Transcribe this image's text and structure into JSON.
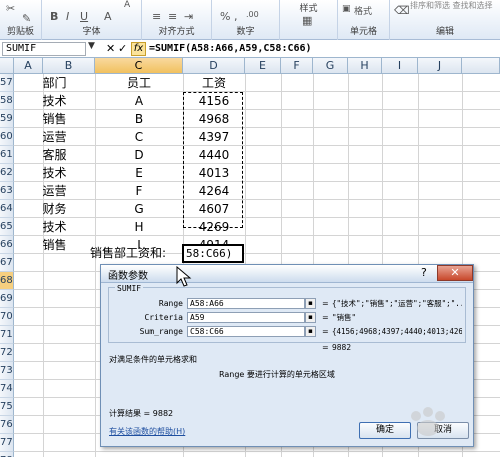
{
  "ribbon": {
    "groups": [
      {
        "label": "剪贴板",
        "icon": "paste-icon"
      },
      {
        "label": "字体",
        "icon": "bold-icon"
      },
      {
        "label": "对齐方式",
        "icon": "align-icon"
      },
      {
        "label": "数字",
        "icon": "percent-icon"
      },
      {
        "label": "样式",
        "icon": "styles-icon"
      },
      {
        "label": "单元格",
        "icon": "cells-icon"
      },
      {
        "label": "编辑",
        "icon": "edit-icon"
      }
    ],
    "styles_top": "样式",
    "sort_filter": "排序和筛选 查找和选择",
    "format_label": "格式"
  },
  "formula_bar": {
    "name_box": "SUMIF",
    "cancel_icon": "✕",
    "enter_icon": "✓",
    "fx_label": "fx",
    "formula": "=SUMIF(A58:A66,A59,C58:C66)"
  },
  "sheet": {
    "columns": [
      "A",
      "B",
      "C",
      "D",
      "E",
      "F",
      "G",
      "H",
      "I",
      "J"
    ],
    "selected_column": "C",
    "rows": [
      "57",
      "58",
      "59",
      "60",
      "61",
      "62",
      "63",
      "64",
      "65",
      "66",
      "67",
      "68",
      "69",
      "70",
      "71",
      "72",
      "73",
      "74",
      "75",
      "76",
      "77",
      "78"
    ],
    "selected_row": "68",
    "header_row": {
      "dept": "部门",
      "employee": "员工",
      "salary": "工资"
    },
    "data": [
      {
        "dept": "技术",
        "employee": "A",
        "salary": "4156"
      },
      {
        "dept": "销售",
        "employee": "B",
        "salary": "4968"
      },
      {
        "dept": "运营",
        "employee": "C",
        "salary": "4397"
      },
      {
        "dept": "客服",
        "employee": "D",
        "salary": "4440"
      },
      {
        "dept": "技术",
        "employee": "E",
        "salary": "4013"
      },
      {
        "dept": "运营",
        "employee": "F",
        "salary": "4264"
      },
      {
        "dept": "财务",
        "employee": "G",
        "salary": "4607"
      },
      {
        "dept": "技术",
        "employee": "H",
        "salary": "4269"
      },
      {
        "dept": "销售",
        "employee": "I",
        "salary": "4914"
      }
    ],
    "sum_label": "销售部工资和:",
    "editing_cell_text": "58:C66)"
  },
  "dialog": {
    "title": "函数参数",
    "help_glyph": "?",
    "close_glyph": "✕",
    "function_name": "SUMIF",
    "args": [
      {
        "label": "Range",
        "value": "A58:A66",
        "result": "{\"技术\";\"销售\";\"运营\";\"客服\";\"..."
      },
      {
        "label": "Criteria",
        "value": "A59",
        "result": "\"销售\""
      },
      {
        "label": "Sum_range",
        "value": "C58:C66",
        "result": "{4156;4968;4397;4440;4013;4264..."
      }
    ],
    "equals": "=",
    "total_result": "9882",
    "description": "对满足条件的单元格求和",
    "arg_help": "Range  要进行计算的单元格区域",
    "calc_result": "计算结果 = 9882",
    "help_link": "有关该函数的帮助(H)",
    "ok_label": "确定",
    "cancel_label": "取消"
  },
  "watermark": {
    "text": "Baidu 经验"
  }
}
